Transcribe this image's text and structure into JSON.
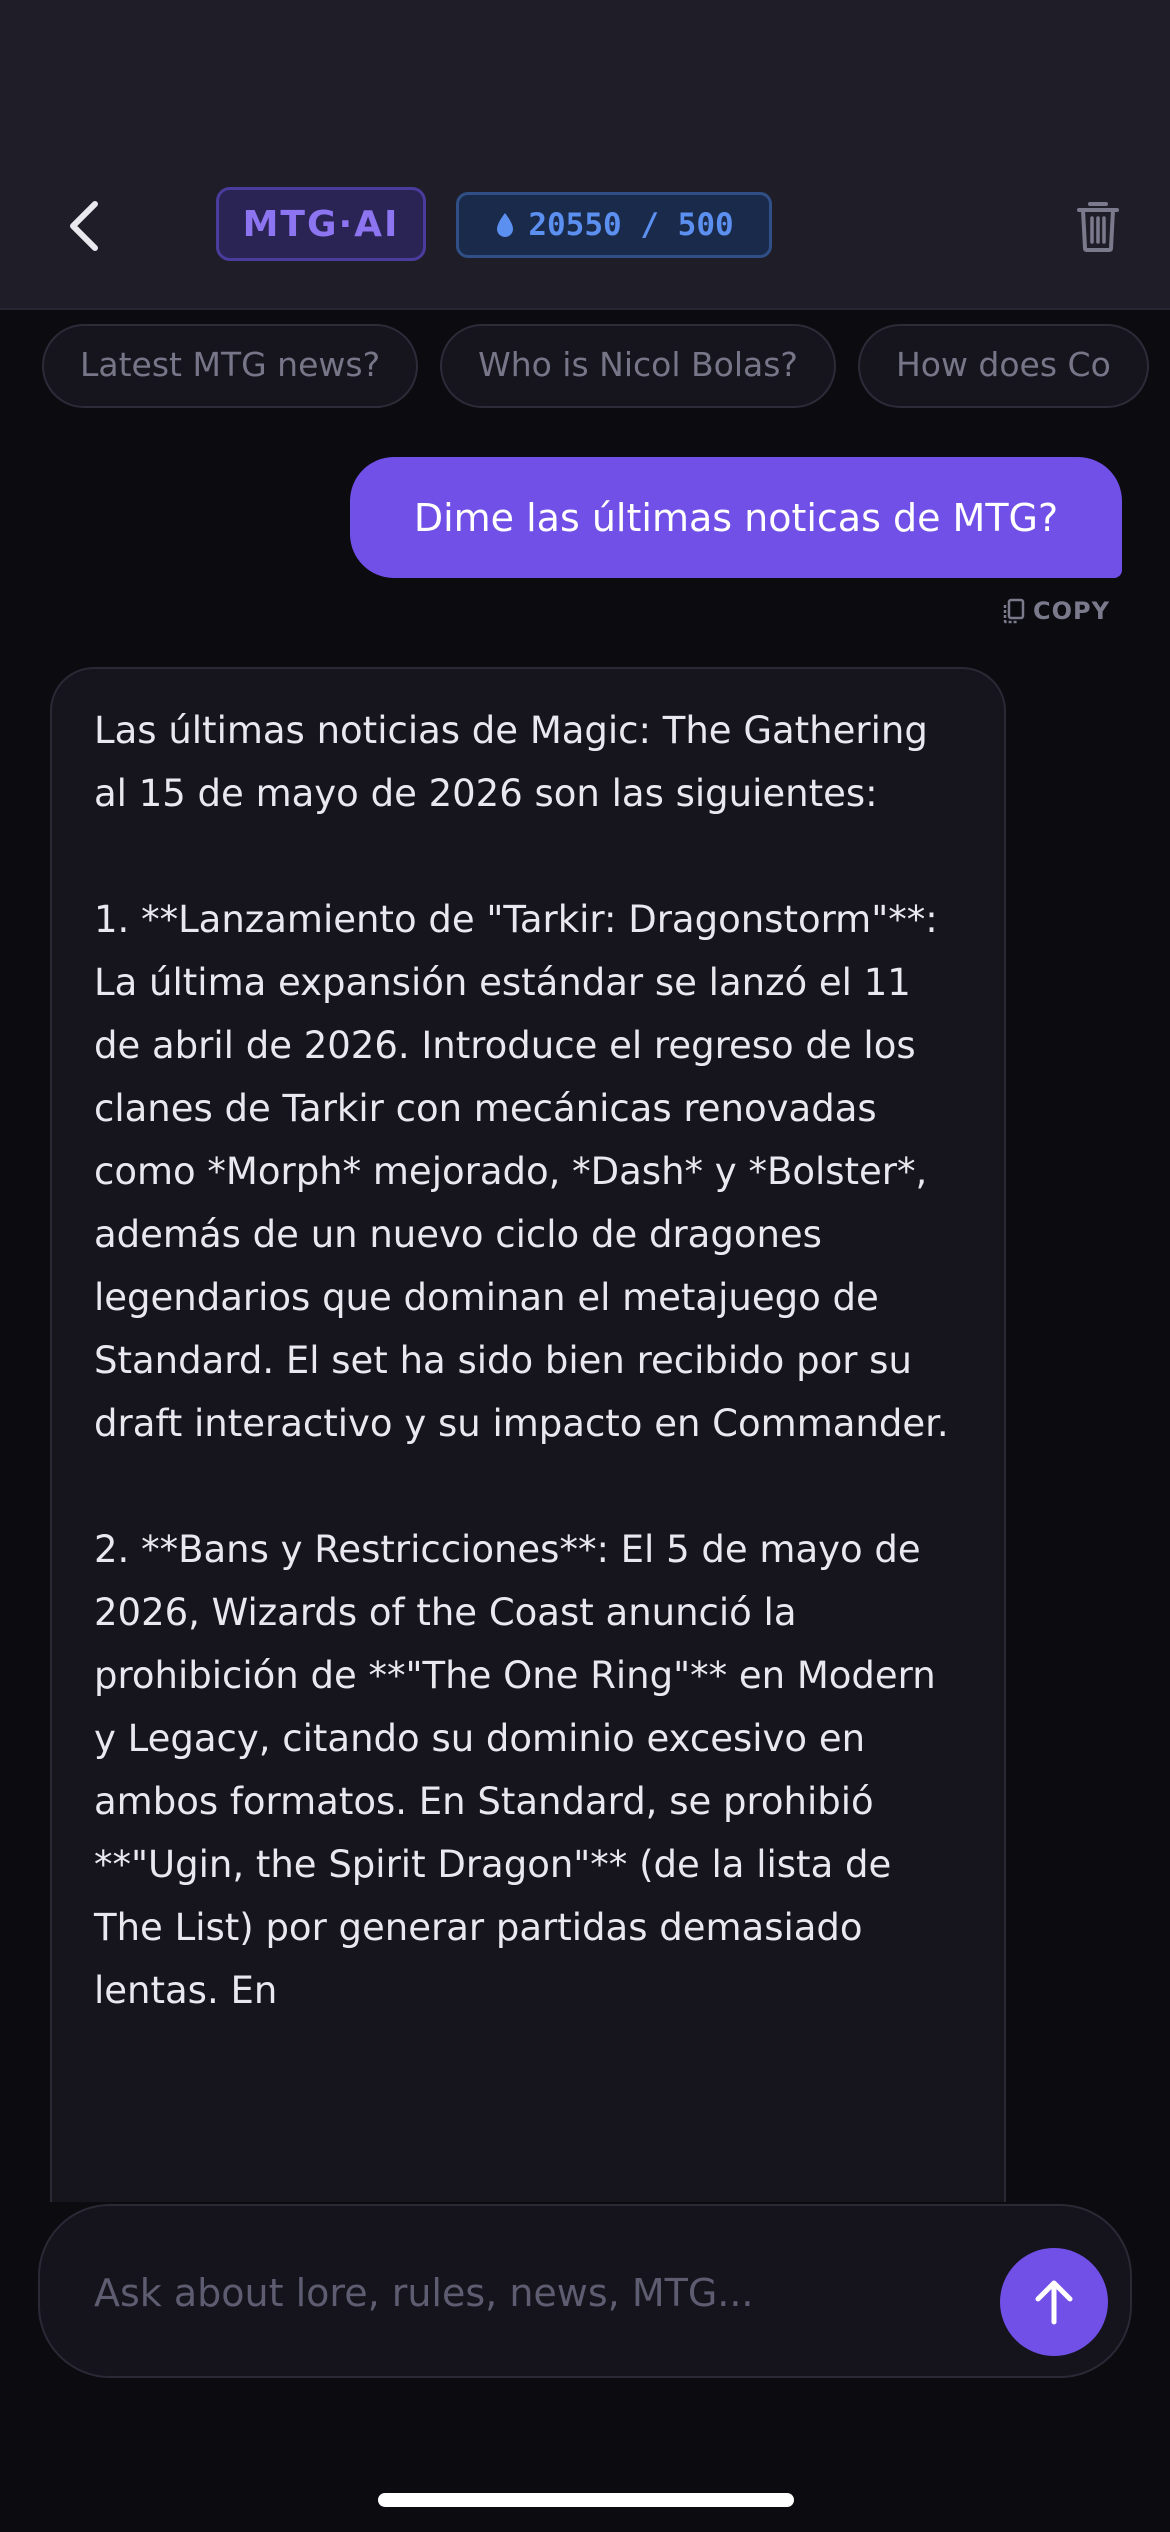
{
  "header": {
    "brand": "MTG·AI",
    "credits": "20550 / 500"
  },
  "suggestions": [
    "Latest MTG news?",
    "Who is Nicol Bolas?",
    "How does Co"
  ],
  "conversation": {
    "user_message": "Dime las últimas noticas de MTG?",
    "copy_label": "COPY",
    "assistant_message": "Las últimas noticias de Magic: The Gathering al 15 de mayo de 2026 son las siguientes:\n\n1. **Lanzamiento de \"Tarkir: Dragonstorm\"**: La última expansión estándar se lanzó el 11 de abril de 2026. Introduce el regreso de los clanes de Tarkir con mecánicas renovadas como *Morph* mejorado, *Dash* y *Bolster*, además de un nuevo ciclo de dragones legendarios que dominan el metajuego de Standard. El set ha sido bien recibido por su draft interactivo y su impacto en Commander.\n\n2. **Bans y Restricciones**: El 5 de mayo de 2026, Wizards of the Coast anunció la prohibición de **\"The One Ring\"** en Modern y Legacy, citando su dominio excesivo en ambos formatos. En Standard, se prohibió **\"Ugin, the Spirit Dragon\"** (de la lista de The List) por generar partidas demasiado lentas. En"
  },
  "composer": {
    "placeholder": "Ask about lore, rules, news, MTG..."
  },
  "colors": {
    "accent": "#7150e8",
    "credits": "#5b8ff0",
    "background": "#0b0b10",
    "header": "#1e1d28"
  },
  "icons": {
    "back": "chevron-left-icon",
    "credits": "drop-icon",
    "delete": "trash-icon",
    "copy": "copy-icon",
    "send": "arrow-up-icon"
  }
}
